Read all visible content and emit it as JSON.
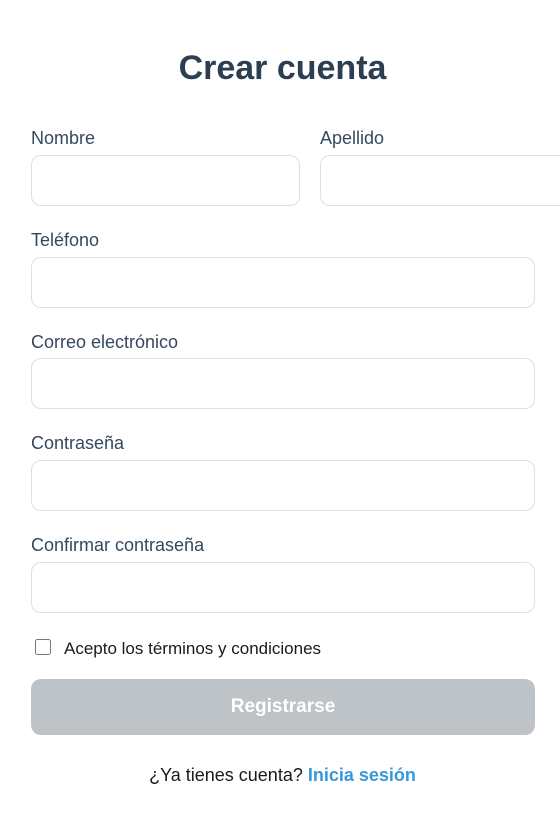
{
  "form": {
    "title": "Crear cuenta",
    "fields": {
      "first_name": {
        "label": "Nombre",
        "value": ""
      },
      "last_name": {
        "label": "Apellido",
        "value": ""
      },
      "phone": {
        "label": "Teléfono",
        "value": ""
      },
      "email": {
        "label": "Correo electrónico",
        "value": ""
      },
      "password": {
        "label": "Contraseña",
        "value": ""
      },
      "confirm_password": {
        "label": "Confirmar contraseña",
        "value": ""
      }
    },
    "terms": {
      "label": "Acepto los términos y condiciones",
      "checked": false
    },
    "submit_label": "Registrarse",
    "submit_disabled": true,
    "footer": {
      "prompt": "¿Ya tienes cuenta?",
      "link_label": "Inicia sesión"
    }
  },
  "colors": {
    "title": "#2c3e50",
    "label": "#34495e",
    "input_border": "#dcdfe3",
    "button_disabled": "#bdc3c7",
    "link": "#3498db"
  }
}
